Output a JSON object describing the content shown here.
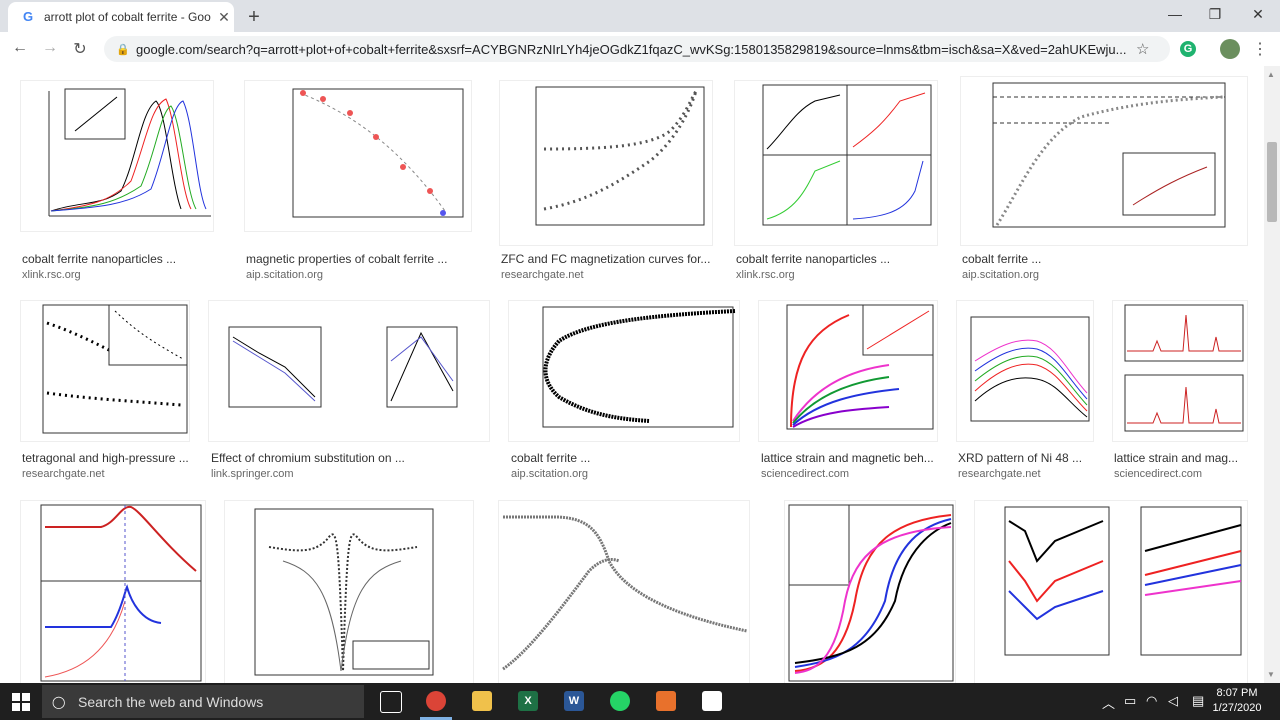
{
  "browser": {
    "tab_title": "arrott plot of cobalt ferrite - Goo",
    "tab_favicon": "G",
    "url": "google.com/search?q=arrott+plot+of+cobalt+ferrite&sxsrf=ACYBGNRzNIrLYh4jeOGdkZ1fqazC_wvKSg:1580135829819&source=lnms&tbm=isch&sa=X&ved=2ahUKEwju...",
    "extension_badge": "G"
  },
  "results": [
    {
      "caption": "cobalt ferrite nanoparticles ...",
      "source": "xlink.rsc.org"
    },
    {
      "caption": "magnetic properties of cobalt ferrite ...",
      "source": "aip.scitation.org"
    },
    {
      "caption": "ZFC and FC magnetization curves for...",
      "source": "researchgate.net"
    },
    {
      "caption": "cobalt ferrite nanoparticles ...",
      "source": "xlink.rsc.org"
    },
    {
      "caption": "cobalt ferrite ...",
      "source": "aip.scitation.org"
    },
    {
      "caption": "tetragonal and high-pressure ...",
      "source": "researchgate.net"
    },
    {
      "caption": "Effect of chromium substitution on ...",
      "source": "link.springer.com"
    },
    {
      "caption": "cobalt ferrite ...",
      "source": "aip.scitation.org"
    },
    {
      "caption": "lattice strain and magnetic beh...",
      "source": "sciencedirect.com"
    },
    {
      "caption": "XRD pattern of Ni 48 ...",
      "source": "researchgate.net"
    },
    {
      "caption": "lattice strain and mag...",
      "source": "sciencedirect.com"
    }
  ],
  "taskbar": {
    "search_placeholder": "Search the web and Windows",
    "time": "8:07 PM",
    "date": "1/27/2020"
  },
  "icons": {
    "tab_close": "close-icon",
    "new_tab": "plus-icon",
    "back": "back-arrow-icon",
    "forward": "forward-arrow-icon",
    "reload": "reload-icon",
    "lock": "lock-icon",
    "bookmark": "star-icon"
  }
}
